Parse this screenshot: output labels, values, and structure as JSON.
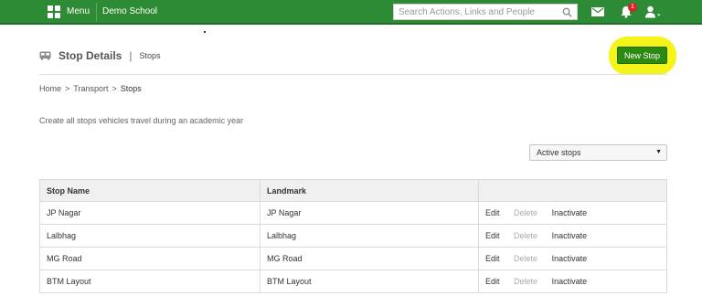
{
  "header": {
    "menu_label": "Menu",
    "school_name": "Demo School",
    "search_placeholder": "Search Actions, Links and People",
    "notification_count": "1",
    "accent_color": "#2e8b35"
  },
  "page": {
    "title": "Stop Details",
    "subtitle": "Stops",
    "new_button": "New Stop"
  },
  "breadcrumb": {
    "items": [
      "Home",
      "Transport"
    ],
    "current": "Stops",
    "separator": ">"
  },
  "description": "Create all stops vehicles travel during an academic year",
  "filter": {
    "selected": "Active stops"
  },
  "table": {
    "headers": [
      "Stop Name",
      "Landmark",
      ""
    ],
    "actions": [
      "Edit",
      "Delete",
      "Inactivate"
    ],
    "rows": [
      {
        "stop_name": "JP Nagar",
        "landmark": "JP Nagar"
      },
      {
        "stop_name": "Lalbhag",
        "landmark": "Lalbhag"
      },
      {
        "stop_name": "MG Road",
        "landmark": "MG Road"
      },
      {
        "stop_name": "BTM Layout",
        "landmark": "BTM Layout"
      }
    ]
  }
}
